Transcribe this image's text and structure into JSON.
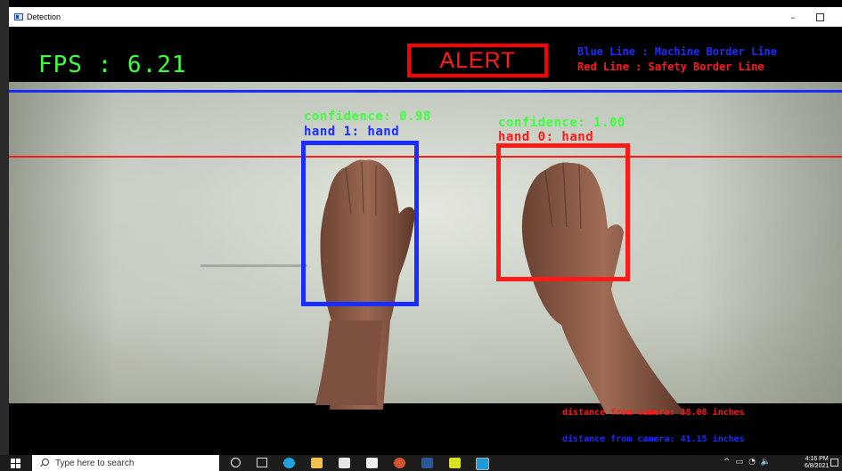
{
  "window": {
    "title": "Detection",
    "controls": {
      "minimize": "–",
      "maximize": "□"
    }
  },
  "overlay": {
    "fps": "FPS : 6.21",
    "alert": "ALERT",
    "legend": {
      "blue": "Blue Line : Machine Border Line",
      "red": "Red Line : Safety Border Line"
    },
    "detections": [
      {
        "confidence": "confidence: 0.98",
        "label": "hand 1: hand",
        "color": "#1a2cff"
      },
      {
        "confidence": "confidence: 1.00",
        "label": "hand 0: hand",
        "color": "#ff1a1a"
      }
    ],
    "distances": {
      "red": "distance from camera: 38.08 inches",
      "blue": "distance from camera: 41.15 inches"
    }
  },
  "colors": {
    "fps": "#3dff3d",
    "alert": "#ff1a1a",
    "machine_line": "#1a2cff",
    "safety_line": "#ff1a1a"
  },
  "taskbar": {
    "search_placeholder": "Type here to search",
    "pinned": [
      "cortana-icon",
      "task-view-icon",
      "edge-icon",
      "file-explorer-icon",
      "store-icon",
      "mail-icon",
      "powerpoint-icon",
      "word-icon",
      "photos-icon",
      "detection-app-icon"
    ],
    "tray": {
      "chevron": "^",
      "sound": "🔈"
    },
    "clock": {
      "time": "4:16 PM",
      "date": "6/8/2021"
    }
  }
}
